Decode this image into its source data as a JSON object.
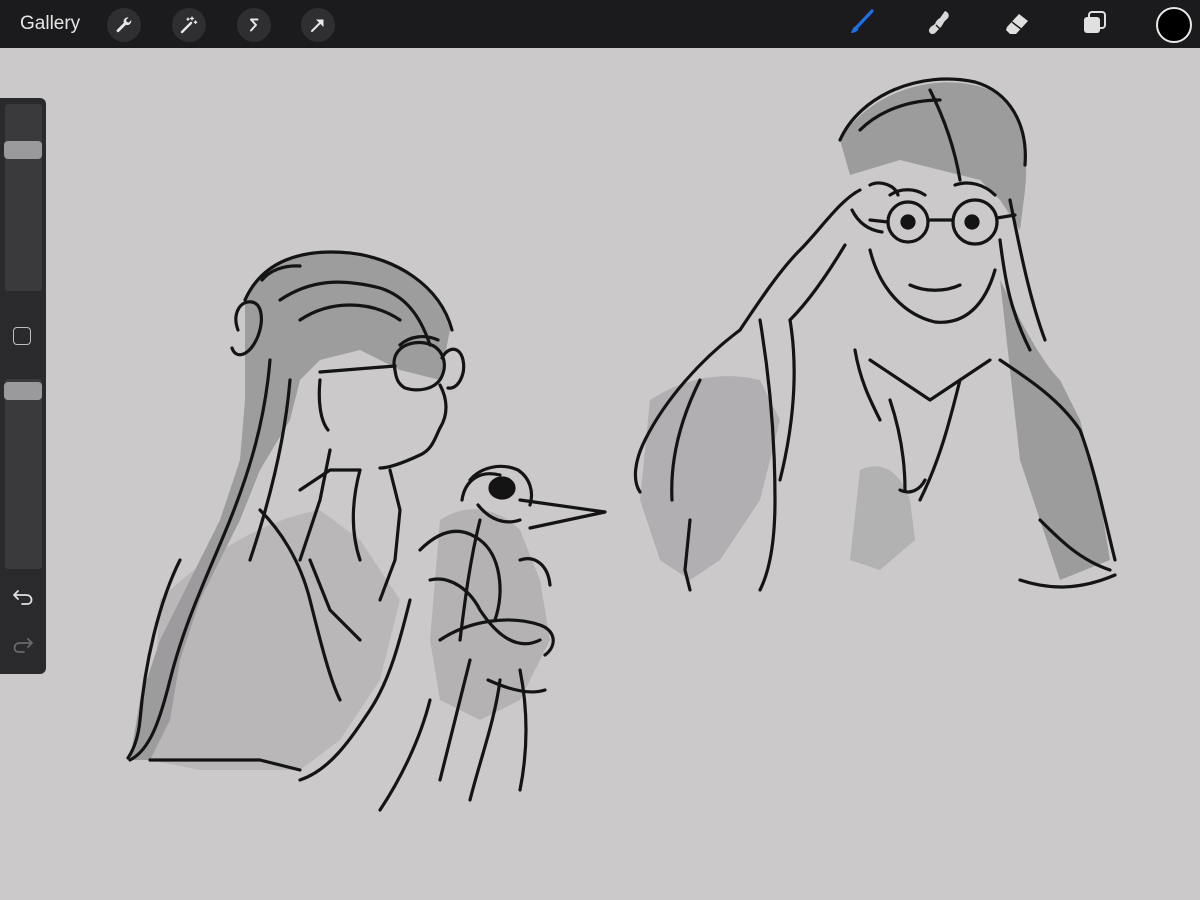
{
  "toolbar": {
    "gallery_label": "Gallery",
    "left_tools": [
      {
        "name": "actions",
        "icon": "wrench-icon"
      },
      {
        "name": "adjustments",
        "icon": "magic-wand-icon"
      },
      {
        "name": "selection",
        "icon": "selection-s-icon"
      },
      {
        "name": "transform",
        "icon": "arrow-cursor-icon"
      }
    ],
    "right_tools": [
      {
        "name": "brush",
        "icon": "brush-icon",
        "active": true
      },
      {
        "name": "smudge",
        "icon": "smudge-icon",
        "active": false
      },
      {
        "name": "eraser",
        "icon": "eraser-icon",
        "active": false
      },
      {
        "name": "layers",
        "icon": "layers-icon",
        "active": false
      }
    ],
    "current_color": "#000000",
    "active_color": "#1e6fe8"
  },
  "sidebar": {
    "brush_size_level": 0.78,
    "opacity_level": 0.98,
    "undo_icon": "undo-icon",
    "redo_icon": "redo-icon",
    "modifier_icon": "square-modifier-icon"
  },
  "canvas": {
    "background": "#cbc9ca",
    "content": "sketch-artwork"
  }
}
